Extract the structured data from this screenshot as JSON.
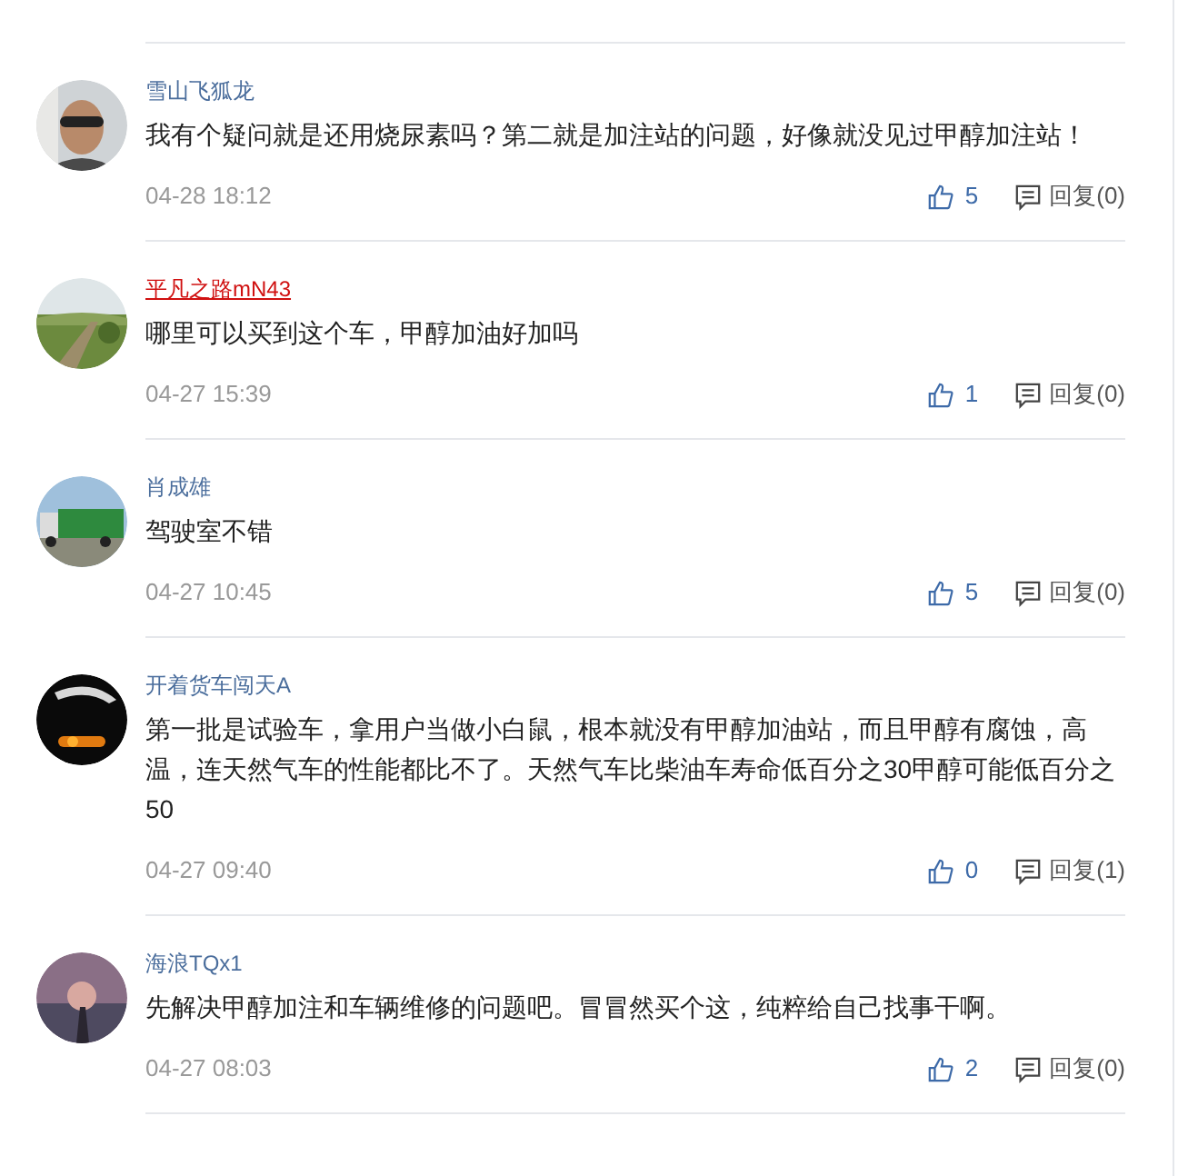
{
  "comments": [
    {
      "name": "雪山飞狐龙",
      "highlighted": false,
      "text": "我有个疑问就是还用烧尿素吗？第二就是加注站的问题，好像就没见过甲醇加注站！",
      "time": "04-28 18:12",
      "likes": "5",
      "reply": "回复(0)"
    },
    {
      "name": "平凡之路mN43",
      "highlighted": true,
      "text": "哪里可以买到这个车，甲醇加油好加吗",
      "time": "04-27 15:39",
      "likes": "1",
      "reply": "回复(0)"
    },
    {
      "name": "肖成雄",
      "highlighted": false,
      "text": "驾驶室不错",
      "time": "04-27 10:45",
      "likes": "5",
      "reply": "回复(0)"
    },
    {
      "name": "开着货车闯天A",
      "highlighted": false,
      "text": "第一批是试验车，拿用户当做小白鼠，根本就没有甲醇加油站，而且甲醇有腐蚀，高温，连天然气车的性能都比不了。天然气车比柴油车寿命低百分之30甲醇可能低百分之50",
      "time": "04-27 09:40",
      "likes": "0",
      "reply": "回复(1)"
    },
    {
      "name": "海浪TQx1",
      "highlighted": false,
      "text": "先解决甲醇加注和车辆维修的问题吧。冒冒然买个这，纯粹给自己找事干啊。",
      "time": "04-27 08:03",
      "likes": "2",
      "reply": "回复(0)"
    }
  ]
}
